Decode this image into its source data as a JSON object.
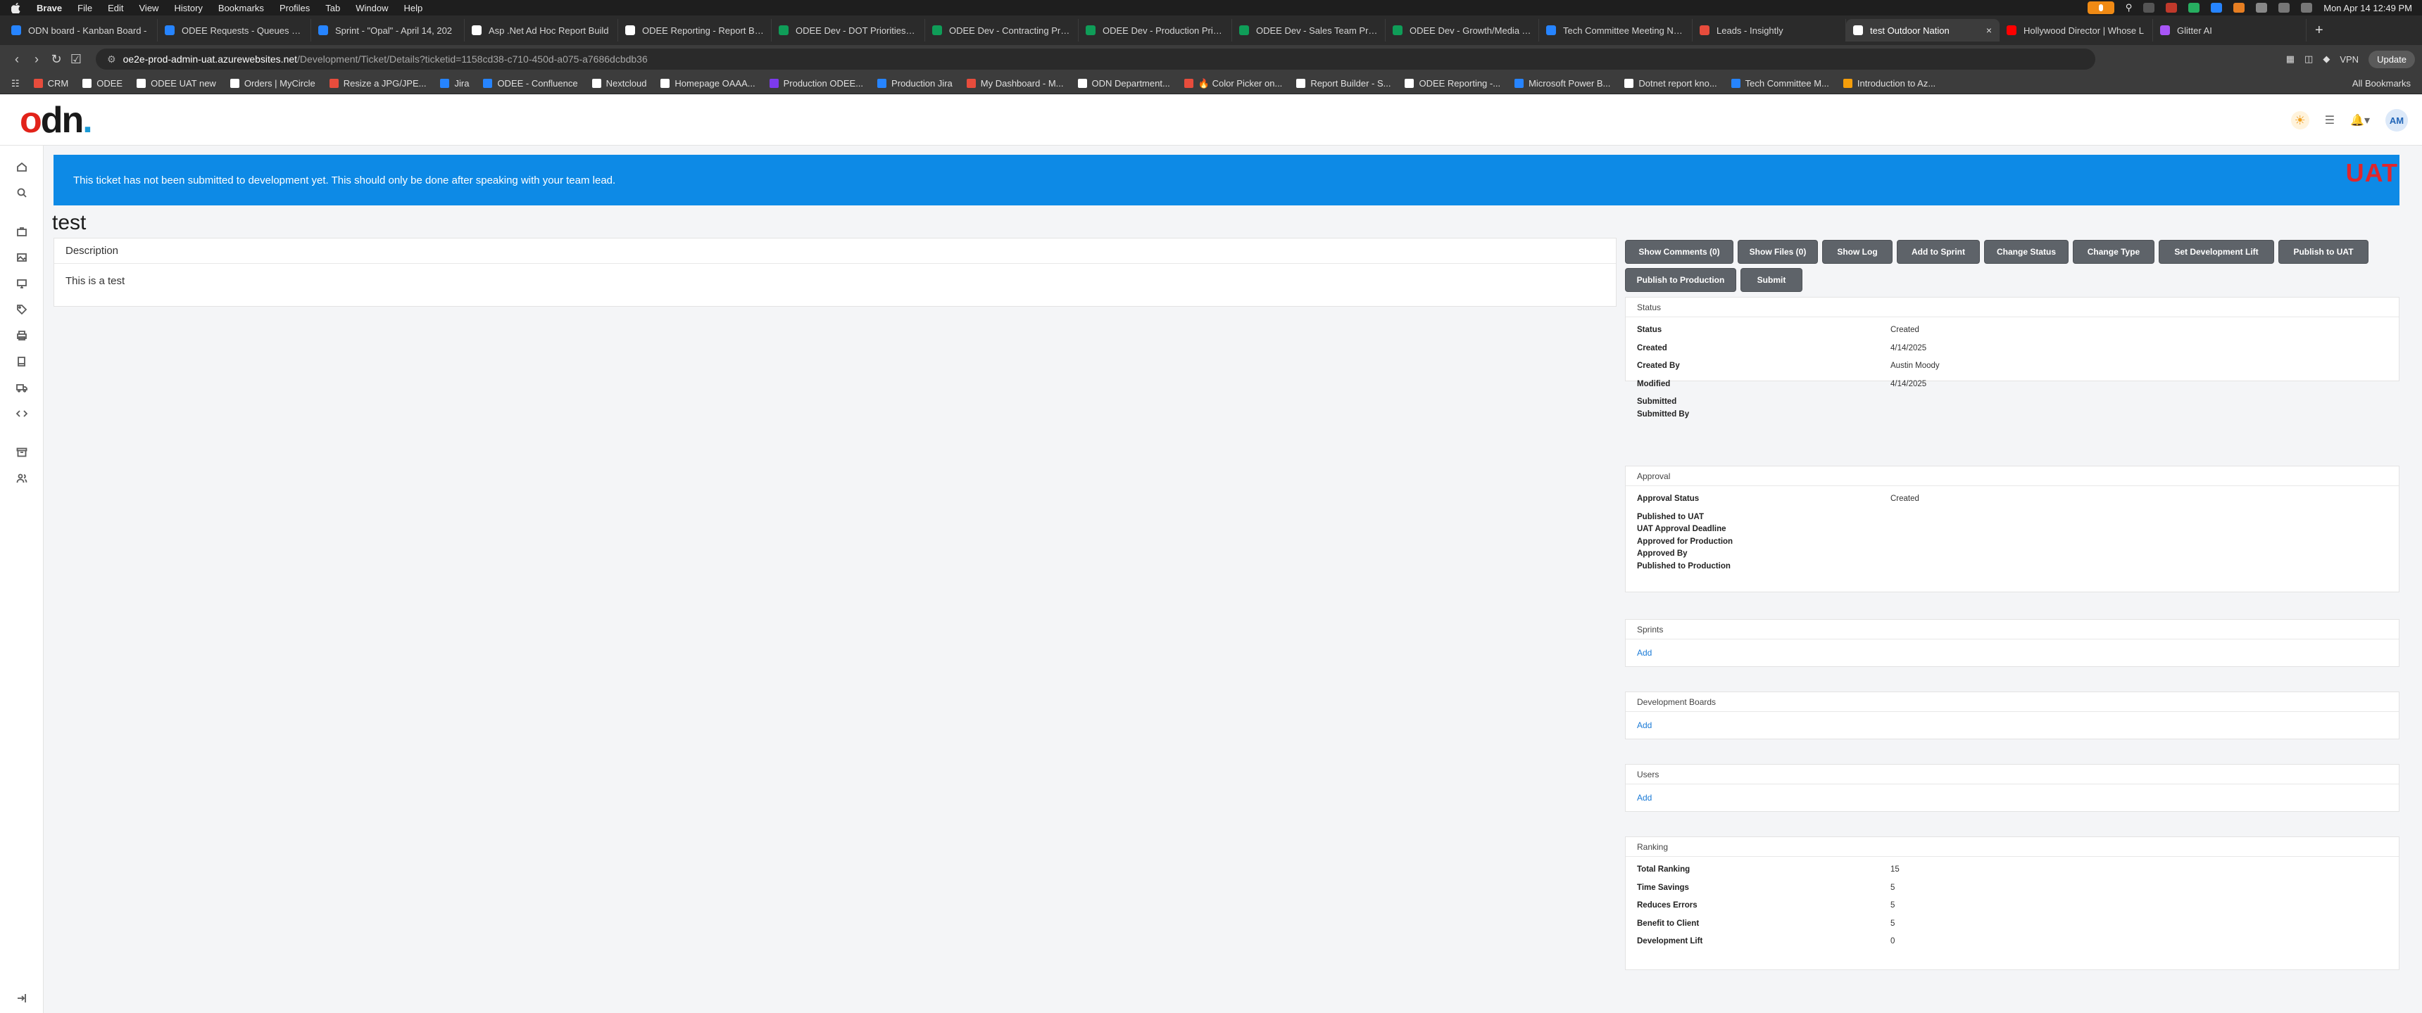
{
  "menubar": {
    "app": "Brave",
    "menus": [
      "File",
      "Edit",
      "View",
      "History",
      "Bookmarks",
      "Profiles",
      "Tab",
      "Window",
      "Help"
    ],
    "clock": "Mon Apr 14  12:49 PM"
  },
  "tabs": [
    {
      "title": "ODN board - Kanban Board -",
      "color": "#2684ff"
    },
    {
      "title": "ODEE Requests - Queues - All",
      "color": "#2684ff"
    },
    {
      "title": "Sprint - \"Opal\" - April 14, 202",
      "color": "#2684ff"
    },
    {
      "title": "Asp .Net Ad Hoc Report Build",
      "color": "#ffffff"
    },
    {
      "title": "ODEE Reporting - Report Build",
      "color": "#ffffff"
    },
    {
      "title": "ODEE Dev - DOT Priorities List",
      "color": "#0f9d58"
    },
    {
      "title": "ODEE Dev - Contracting Priorit",
      "color": "#0f9d58"
    },
    {
      "title": "ODEE Dev - Production Priorit",
      "color": "#0f9d58"
    },
    {
      "title": "ODEE Dev - Sales Team Priorit",
      "color": "#0f9d58"
    },
    {
      "title": "ODEE Dev - Growth/Media Tea",
      "color": "#0f9d58"
    },
    {
      "title": "Tech Committee Meeting Note",
      "color": "#2684ff"
    },
    {
      "title": "Leads - Insightly",
      "color": "#e74c3c"
    },
    {
      "title": "test Outdoor Nation",
      "color": "#ffffff",
      "active": true
    },
    {
      "title": "Hollywood Director | Whose L",
      "color": "#ff0000"
    },
    {
      "title": "Glitter AI",
      "color": "#a855f7"
    }
  ],
  "address": {
    "host": "oe2e-prod-admin-uat.azurewebsites.net",
    "path": "/Development/Ticket/Details?ticketid=1158cd38-c710-450d-a075-a7686dcbdb36",
    "vpn": "VPN",
    "update": "Update"
  },
  "bookmarks": [
    {
      "label": "CRM",
      "color": "#e74c3c"
    },
    {
      "label": "ODEE",
      "color": "#ffffff"
    },
    {
      "label": "ODEE UAT new",
      "color": "#ffffff"
    },
    {
      "label": "Orders | MyCircle",
      "color": "#ffffff"
    },
    {
      "label": "Resize a JPG/JPE...",
      "color": "#e74c3c"
    },
    {
      "label": "Jira",
      "color": "#2684ff"
    },
    {
      "label": "ODEE - Confluence",
      "color": "#2684ff"
    },
    {
      "label": "Nextcloud",
      "color": "#ffffff"
    },
    {
      "label": "Homepage OAAA...",
      "color": "#ffffff"
    },
    {
      "label": "Production ODEE...",
      "color": "#7c3aed"
    },
    {
      "label": "Production Jira",
      "color": "#2684ff"
    },
    {
      "label": "My Dashboard - M...",
      "color": "#e74c3c"
    },
    {
      "label": "ODN Department...",
      "color": "#ffffff"
    },
    {
      "label": "🔥 Color Picker on...",
      "color": "#e74c3c"
    },
    {
      "label": "Report Builder - S...",
      "color": "#ffffff"
    },
    {
      "label": "ODEE Reporting -...",
      "color": "#ffffff"
    },
    {
      "label": "Microsoft Power B...",
      "color": "#2684ff"
    },
    {
      "label": "Dotnet report kno...",
      "color": "#ffffff"
    },
    {
      "label": "Tech Committee M...",
      "color": "#2684ff"
    },
    {
      "label": "Introduction to Az...",
      "color": "#f59e0b"
    }
  ],
  "bookmarks_all": "All Bookmarks",
  "header": {
    "logo_o": "o",
    "logo_d": "d",
    "logo_n": "n",
    "logo_dot": ".",
    "avatar": "AM"
  },
  "alert": "This ticket has not been submitted to development yet. This should only be done after speaking with your team lead.",
  "env_badge": "UAT",
  "ticket": {
    "title": "test",
    "description_label": "Description",
    "description": "This is a test"
  },
  "actions": [
    {
      "label": "Show Comments (0)"
    },
    {
      "label": "Show Files (0)"
    },
    {
      "label": "Show Log"
    },
    {
      "label": "Add to Sprint"
    },
    {
      "label": "Change Status"
    },
    {
      "label": "Change Type"
    },
    {
      "label": "Set Development Lift"
    },
    {
      "label": "Publish to UAT"
    },
    {
      "label": "Publish to Production"
    },
    {
      "label": "Submit"
    }
  ],
  "status_panel": {
    "title": "Status",
    "rows": [
      {
        "k": "Status",
        "v": "Created"
      },
      {
        "k": "Created",
        "v": "4/14/2025"
      },
      {
        "k": "Created By",
        "v": "Austin Moody"
      },
      {
        "k": "Modified",
        "v": "4/14/2025"
      },
      {
        "k": "Submitted",
        "v": ""
      },
      {
        "k": "Submitted By",
        "v": ""
      }
    ]
  },
  "approval_panel": {
    "title": "Approval",
    "rows": [
      {
        "k": "Approval Status",
        "v": "Created"
      },
      {
        "k": "Published to UAT",
        "v": ""
      },
      {
        "k": "UAT Approval Deadline",
        "v": ""
      },
      {
        "k": "Approved for Production",
        "v": ""
      },
      {
        "k": "Approved By",
        "v": ""
      },
      {
        "k": "Published to Production",
        "v": ""
      }
    ]
  },
  "sprints_panel": {
    "title": "Sprints",
    "link": "Add"
  },
  "boards_panel": {
    "title": "Development Boards",
    "link": "Add"
  },
  "users_panel": {
    "title": "Users",
    "link": "Add"
  },
  "ranking_panel": {
    "title": "Ranking",
    "rows": [
      {
        "k": "Total Ranking",
        "v": "15"
      },
      {
        "k": "Time Savings",
        "v": "5"
      },
      {
        "k": "Reduces Errors",
        "v": "5"
      },
      {
        "k": "Benefit to Client",
        "v": "5"
      },
      {
        "k": "Development Lift",
        "v": "0"
      }
    ]
  },
  "sidebar_icons": [
    "home-icon",
    "search-icon",
    "briefcase-icon",
    "image-icon",
    "monitor-icon",
    "tag-icon",
    "printer-icon",
    "book-icon",
    "truck-icon",
    "code-icon",
    "archive-icon",
    "users-icon",
    "logout-icon"
  ]
}
